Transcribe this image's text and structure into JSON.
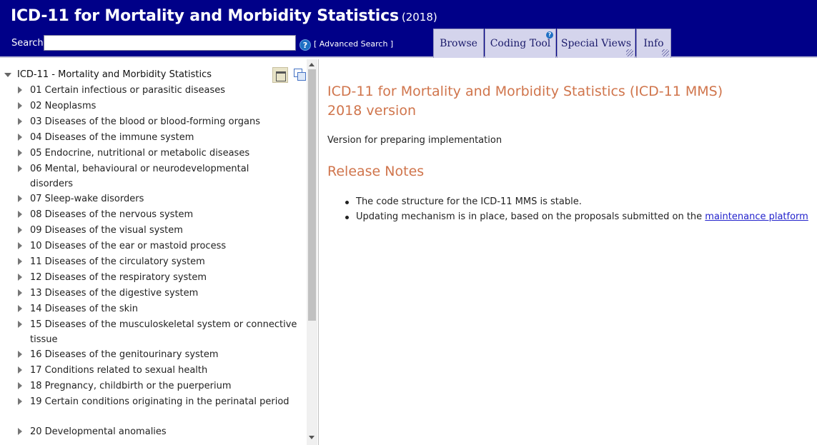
{
  "header": {
    "title": "ICD-11 for Mortality and Morbidity Statistics",
    "year": "(2018)",
    "search_label": "Search",
    "search_value": "",
    "help_icon_text": "?",
    "advanced_search": "[ Advanced Search ]",
    "tabs": [
      {
        "label": "Browse"
      },
      {
        "label": "Coding Tool",
        "badge": "?"
      },
      {
        "label": "Special Views"
      },
      {
        "label": "Info"
      }
    ],
    "colors": {
      "bar": "#000088",
      "tab": "#d4d4ec"
    }
  },
  "tree": {
    "root": "ICD-11 - Mortality and Morbidity Statistics",
    "items": [
      {
        "label": "01 Certain infectious or parasitic diseases"
      },
      {
        "label": "02 Neoplasms"
      },
      {
        "label": "03 Diseases of the blood or blood-forming organs"
      },
      {
        "label": "04 Diseases of the immune system"
      },
      {
        "label": "05 Endocrine, nutritional or metabolic diseases"
      },
      {
        "label": "06 Mental, behavioural or neurodevelopmental disorders"
      },
      {
        "label": "07 Sleep-wake disorders"
      },
      {
        "label": "08 Diseases of the nervous system"
      },
      {
        "label": "09 Diseases of the visual system"
      },
      {
        "label": "10 Diseases of the ear or mastoid process"
      },
      {
        "label": "11 Diseases of the circulatory system"
      },
      {
        "label": "12 Diseases of the respiratory system"
      },
      {
        "label": "13 Diseases of the digestive system"
      },
      {
        "label": "14 Diseases of the skin"
      },
      {
        "label": "15 Diseases of the musculoskeletal system or connective tissue"
      },
      {
        "label": "16 Diseases of the genitourinary system"
      },
      {
        "label": "17 Conditions related to sexual health"
      },
      {
        "label": "18 Pregnancy, childbirth or the puerperium"
      },
      {
        "label": "19 Certain conditions originating in the perinatal period"
      },
      {
        "label": "20 Developmental anomalies"
      }
    ]
  },
  "content": {
    "title_line1": "ICD-11 for Mortality and Morbidity Statistics (ICD-11 MMS)",
    "title_line2": "2018 version",
    "subtitle": "Version for preparing implementation",
    "release_notes_title": "Release Notes",
    "notes": [
      {
        "text": "The code structure for the ICD-11 MMS is stable."
      },
      {
        "text": "Updating mechanism is in place, based on the proposals submitted on the ",
        "link": "maintenance platform"
      }
    ],
    "heading_color": "#d0754c"
  }
}
